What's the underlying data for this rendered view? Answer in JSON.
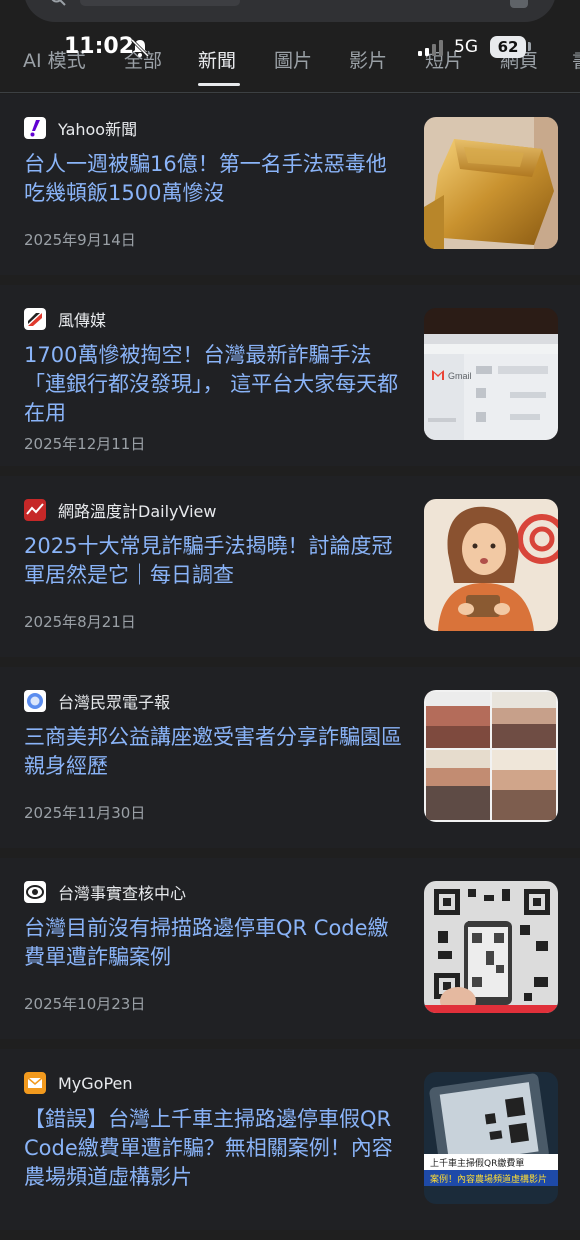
{
  "status": {
    "time": "11:02",
    "network": "5G",
    "battery": "62"
  },
  "tabs": [
    "AI 模式",
    "全部",
    "新聞",
    "圖片",
    "影片",
    "短片",
    "網頁",
    "書"
  ],
  "active_tab": "新聞",
  "results": [
    {
      "source": "Yahoo新聞",
      "title": "台人一週被騙16億！第一名手法惡毒他吃幾頓飯1500萬慘沒",
      "date": "2025年9月14日"
    },
    {
      "source": "風傳媒",
      "title": "1700萬慘被掏空！台灣最新詐騙手法「連銀行都沒發現」， 這平台大家每天都在用",
      "date": "2025年12月11日"
    },
    {
      "source": "網路溫度計DailyView",
      "title": "2025十大常見詐騙手法揭曉！討論度冠軍居然是它｜每日調查",
      "date": "2025年8月21日"
    },
    {
      "source": "台灣民眾電子報",
      "title": "三商美邦公益講座邀受害者分享詐騙園區親身經歷",
      "date": "2025年11月30日"
    },
    {
      "source": "台灣事實查核中心",
      "title": "台灣目前沒有掃描路邊停車QR Code繳費單遭詐騙案例",
      "date": "2025年10月23日"
    },
    {
      "source": "MyGoPen",
      "title": "【錯誤】台灣上千車主掃路邊停車假QR Code繳費單遭詐騙？無相關案例！內容農場頻道虛構影片",
      "date": ""
    }
  ],
  "thumb_texts": {
    "gmail": "Gmail",
    "mygopen_caption1": "上千車主掃假QR繳費單",
    "mygopen_caption2": "案例！內容農場頻道虛構影片"
  },
  "colors": {
    "link": "#8ab4f8",
    "background": "#202124",
    "muted": "#9aa0a6"
  }
}
